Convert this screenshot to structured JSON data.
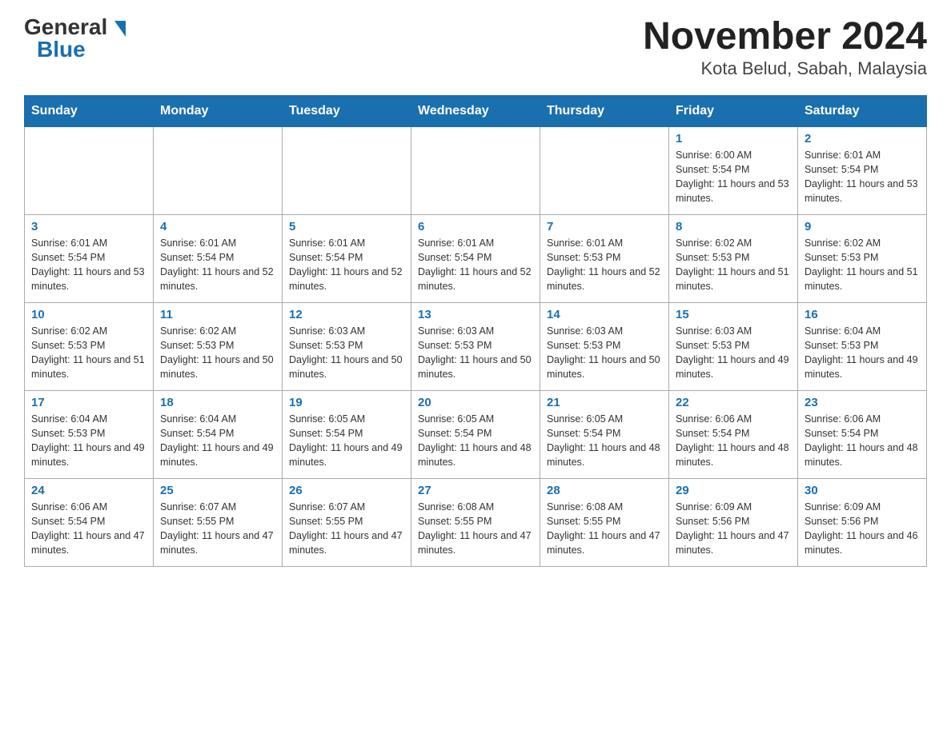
{
  "header": {
    "logo_general": "General",
    "logo_blue": "Blue",
    "title": "November 2024",
    "subtitle": "Kota Belud, Sabah, Malaysia"
  },
  "days_of_week": [
    "Sunday",
    "Monday",
    "Tuesday",
    "Wednesday",
    "Thursday",
    "Friday",
    "Saturday"
  ],
  "weeks": [
    [
      {
        "day": "",
        "info": ""
      },
      {
        "day": "",
        "info": ""
      },
      {
        "day": "",
        "info": ""
      },
      {
        "day": "",
        "info": ""
      },
      {
        "day": "",
        "info": ""
      },
      {
        "day": "1",
        "info": "Sunrise: 6:00 AM\nSunset: 5:54 PM\nDaylight: 11 hours and 53 minutes."
      },
      {
        "day": "2",
        "info": "Sunrise: 6:01 AM\nSunset: 5:54 PM\nDaylight: 11 hours and 53 minutes."
      }
    ],
    [
      {
        "day": "3",
        "info": "Sunrise: 6:01 AM\nSunset: 5:54 PM\nDaylight: 11 hours and 53 minutes."
      },
      {
        "day": "4",
        "info": "Sunrise: 6:01 AM\nSunset: 5:54 PM\nDaylight: 11 hours and 52 minutes."
      },
      {
        "day": "5",
        "info": "Sunrise: 6:01 AM\nSunset: 5:54 PM\nDaylight: 11 hours and 52 minutes."
      },
      {
        "day": "6",
        "info": "Sunrise: 6:01 AM\nSunset: 5:54 PM\nDaylight: 11 hours and 52 minutes."
      },
      {
        "day": "7",
        "info": "Sunrise: 6:01 AM\nSunset: 5:53 PM\nDaylight: 11 hours and 52 minutes."
      },
      {
        "day": "8",
        "info": "Sunrise: 6:02 AM\nSunset: 5:53 PM\nDaylight: 11 hours and 51 minutes."
      },
      {
        "day": "9",
        "info": "Sunrise: 6:02 AM\nSunset: 5:53 PM\nDaylight: 11 hours and 51 minutes."
      }
    ],
    [
      {
        "day": "10",
        "info": "Sunrise: 6:02 AM\nSunset: 5:53 PM\nDaylight: 11 hours and 51 minutes."
      },
      {
        "day": "11",
        "info": "Sunrise: 6:02 AM\nSunset: 5:53 PM\nDaylight: 11 hours and 50 minutes."
      },
      {
        "day": "12",
        "info": "Sunrise: 6:03 AM\nSunset: 5:53 PM\nDaylight: 11 hours and 50 minutes."
      },
      {
        "day": "13",
        "info": "Sunrise: 6:03 AM\nSunset: 5:53 PM\nDaylight: 11 hours and 50 minutes."
      },
      {
        "day": "14",
        "info": "Sunrise: 6:03 AM\nSunset: 5:53 PM\nDaylight: 11 hours and 50 minutes."
      },
      {
        "day": "15",
        "info": "Sunrise: 6:03 AM\nSunset: 5:53 PM\nDaylight: 11 hours and 49 minutes."
      },
      {
        "day": "16",
        "info": "Sunrise: 6:04 AM\nSunset: 5:53 PM\nDaylight: 11 hours and 49 minutes."
      }
    ],
    [
      {
        "day": "17",
        "info": "Sunrise: 6:04 AM\nSunset: 5:53 PM\nDaylight: 11 hours and 49 minutes."
      },
      {
        "day": "18",
        "info": "Sunrise: 6:04 AM\nSunset: 5:54 PM\nDaylight: 11 hours and 49 minutes."
      },
      {
        "day": "19",
        "info": "Sunrise: 6:05 AM\nSunset: 5:54 PM\nDaylight: 11 hours and 49 minutes."
      },
      {
        "day": "20",
        "info": "Sunrise: 6:05 AM\nSunset: 5:54 PM\nDaylight: 11 hours and 48 minutes."
      },
      {
        "day": "21",
        "info": "Sunrise: 6:05 AM\nSunset: 5:54 PM\nDaylight: 11 hours and 48 minutes."
      },
      {
        "day": "22",
        "info": "Sunrise: 6:06 AM\nSunset: 5:54 PM\nDaylight: 11 hours and 48 minutes."
      },
      {
        "day": "23",
        "info": "Sunrise: 6:06 AM\nSunset: 5:54 PM\nDaylight: 11 hours and 48 minutes."
      }
    ],
    [
      {
        "day": "24",
        "info": "Sunrise: 6:06 AM\nSunset: 5:54 PM\nDaylight: 11 hours and 47 minutes."
      },
      {
        "day": "25",
        "info": "Sunrise: 6:07 AM\nSunset: 5:55 PM\nDaylight: 11 hours and 47 minutes."
      },
      {
        "day": "26",
        "info": "Sunrise: 6:07 AM\nSunset: 5:55 PM\nDaylight: 11 hours and 47 minutes."
      },
      {
        "day": "27",
        "info": "Sunrise: 6:08 AM\nSunset: 5:55 PM\nDaylight: 11 hours and 47 minutes."
      },
      {
        "day": "28",
        "info": "Sunrise: 6:08 AM\nSunset: 5:55 PM\nDaylight: 11 hours and 47 minutes."
      },
      {
        "day": "29",
        "info": "Sunrise: 6:09 AM\nSunset: 5:56 PM\nDaylight: 11 hours and 47 minutes."
      },
      {
        "day": "30",
        "info": "Sunrise: 6:09 AM\nSunset: 5:56 PM\nDaylight: 11 hours and 46 minutes."
      }
    ]
  ]
}
